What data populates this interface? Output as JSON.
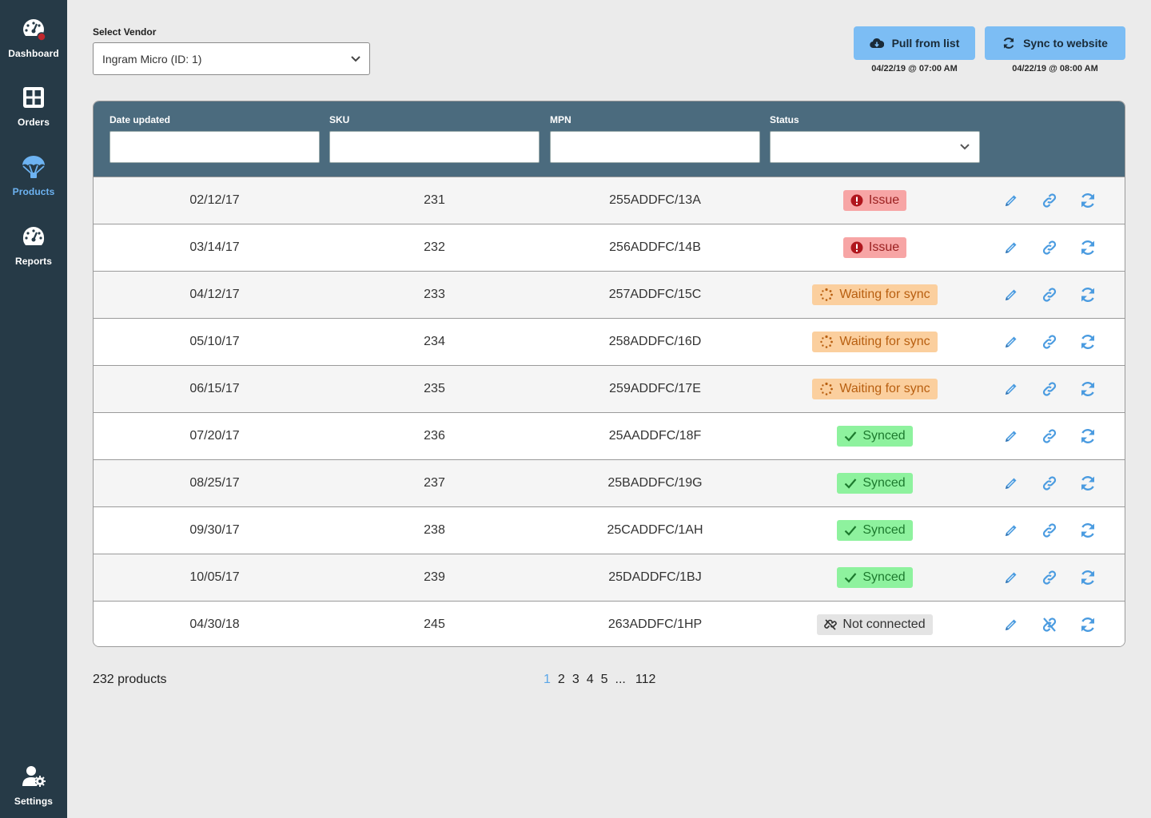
{
  "sidebar": {
    "items": [
      {
        "label": "Dashboard",
        "icon": "dashboard-gauge-icon",
        "active": false
      },
      {
        "label": "Orders",
        "icon": "grid-icon",
        "active": false
      },
      {
        "label": "Products",
        "icon": "parachute-icon",
        "active": true
      },
      {
        "label": "Reports",
        "icon": "gauge-icon",
        "active": false
      }
    ],
    "settings": {
      "label": "Settings",
      "icon": "user-gear-icon"
    }
  },
  "vendor": {
    "label": "Select Vendor",
    "selected": "Ingram Micro (ID: 1)"
  },
  "actions": {
    "pull": {
      "label": "Pull from list",
      "icon": "cloud-download-icon",
      "timestamp": "04/22/19 @ 07:00 AM"
    },
    "sync": {
      "label": "Sync to website",
      "icon": "sync-icon",
      "timestamp": "04/22/19 @ 08:00 AM"
    }
  },
  "table": {
    "filters": {
      "date": {
        "label": "Date updated",
        "value": ""
      },
      "sku": {
        "label": "SKU",
        "value": ""
      },
      "mpn": {
        "label": "MPN",
        "value": ""
      },
      "status": {
        "label": "Status",
        "value": ""
      }
    },
    "rows": [
      {
        "date": "02/12/17",
        "sku": "231",
        "mpn": "255ADDFC/13A",
        "status": "Issue",
        "status_type": "issue"
      },
      {
        "date": "03/14/17",
        "sku": "232",
        "mpn": "256ADDFC/14B",
        "status": "Issue",
        "status_type": "issue"
      },
      {
        "date": "04/12/17",
        "sku": "233",
        "mpn": "257ADDFC/15C",
        "status": "Waiting for sync",
        "status_type": "waiting"
      },
      {
        "date": "05/10/17",
        "sku": "234",
        "mpn": "258ADDFC/16D",
        "status": "Waiting for sync",
        "status_type": "waiting"
      },
      {
        "date": "06/15/17",
        "sku": "235",
        "mpn": "259ADDFC/17E",
        "status": "Waiting for sync",
        "status_type": "waiting"
      },
      {
        "date": "07/20/17",
        "sku": "236",
        "mpn": "25AADDFC/18F",
        "status": "Synced",
        "status_type": "synced"
      },
      {
        "date": "08/25/17",
        "sku": "237",
        "mpn": "25BADDFC/19G",
        "status": "Synced",
        "status_type": "synced"
      },
      {
        "date": "09/30/17",
        "sku": "238",
        "mpn": "25CADDFC/1AH",
        "status": "Synced",
        "status_type": "synced"
      },
      {
        "date": "10/05/17",
        "sku": "239",
        "mpn": "25DADDFC/1BJ",
        "status": "Synced",
        "status_type": "synced"
      },
      {
        "date": "04/30/18",
        "sku": "245",
        "mpn": "263ADDFC/1HP",
        "status": "Not connected",
        "status_type": "notconn"
      }
    ]
  },
  "footer": {
    "count_text": "232 products",
    "pages": [
      "1",
      "2",
      "3",
      "4",
      "5",
      "...",
      "112"
    ],
    "current_page": "1"
  },
  "colors": {
    "sidebar_bg": "#263a47",
    "accent": "#6db3f2",
    "filter_bar": "#4b6b7e",
    "button_bg": "#7cbdf4",
    "icon_blue": "#4a9be0"
  }
}
